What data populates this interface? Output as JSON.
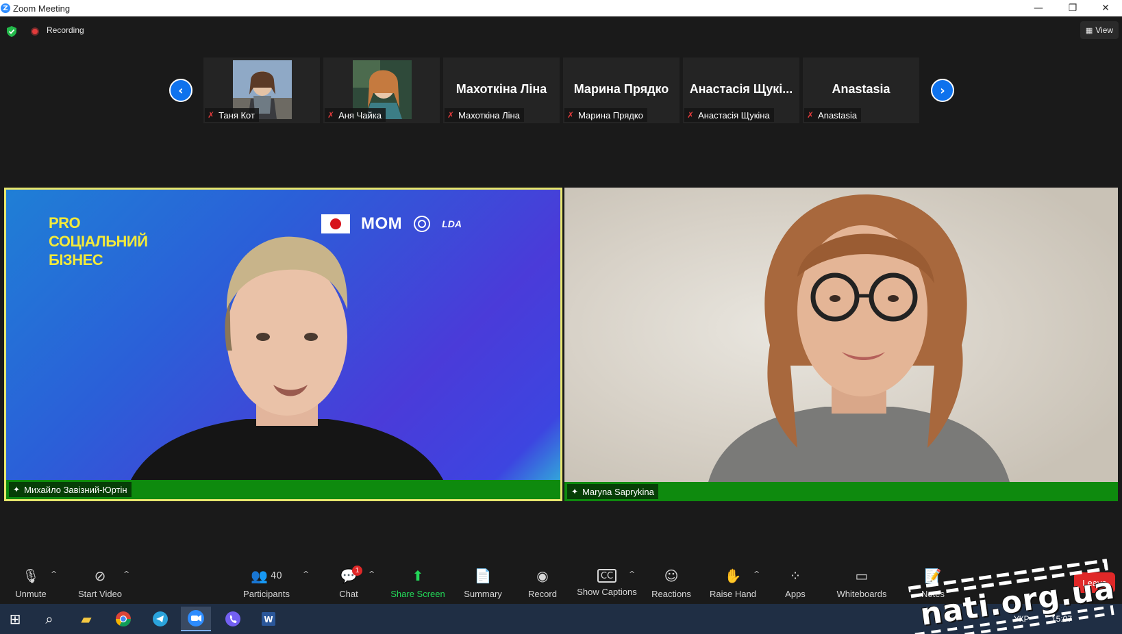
{
  "window": {
    "title": "Zoom Meeting"
  },
  "status": {
    "recording_label": "Recording",
    "view_label": "View"
  },
  "thumbnails": [
    {
      "display_name": "",
      "label": "Таня Кот",
      "has_video": true
    },
    {
      "display_name": "",
      "label": "Аня Чайка",
      "has_video": true
    },
    {
      "display_name": "Махоткіна Ліна",
      "label": "Махоткіна Ліна",
      "has_video": false
    },
    {
      "display_name": "Марина Прядко",
      "label": "Марина Прядко",
      "has_video": false
    },
    {
      "display_name": "Анастасія Щукі...",
      "label": "Анастасія Щукіна",
      "has_video": false
    },
    {
      "display_name": "Anastasia",
      "label": "Anastasia",
      "has_video": false
    }
  ],
  "main": {
    "left": {
      "name": "Михайло Завізний-Юртін",
      "banner_lines": [
        "PRO",
        "СОЦІАЛЬНИЙ",
        "БІЗНЕС"
      ],
      "logo_mom": "МОМ",
      "logo_lda": "LDA"
    },
    "right": {
      "name": "Maryna Saprykina"
    }
  },
  "toolbar": {
    "unmute": "Unmute",
    "start_video": "Start Video",
    "participants": "Participants",
    "participants_count": "40",
    "chat": "Chat",
    "chat_badge": "1",
    "share_screen": "Share Screen",
    "summary": "Summary",
    "record": "Record",
    "show_captions": "Show Captions",
    "reactions": "Reactions",
    "raise_hand": "Raise Hand",
    "apps": "Apps",
    "whiteboards": "Whiteboards",
    "notes": "Notes",
    "leave": "Leave"
  },
  "taskbar": {
    "language": "УКР",
    "time": "15:07"
  },
  "watermark": {
    "text": "nati.org.ua"
  },
  "colors": {
    "accent": "#0e72ed",
    "active_speaker_border": "#e7e66d",
    "name_bar_green": "#0e8a0e",
    "share_green": "#23d959",
    "leave_red": "#e02828"
  },
  "icons": [
    "shield-icon",
    "record-dot-icon",
    "grid-icon",
    "chevron-left-icon",
    "chevron-right-icon",
    "mic-muted-icon",
    "video-off-icon",
    "participants-icon",
    "chat-icon",
    "share-screen-icon",
    "summary-icon",
    "record-icon",
    "captions-icon",
    "reactions-icon",
    "raise-hand-icon",
    "apps-icon",
    "whiteboard-icon",
    "notes-icon",
    "windows-start-icon",
    "search-icon",
    "folder-icon",
    "chrome-icon",
    "telegram-icon",
    "zoom-icon",
    "viber-icon",
    "word-icon"
  ]
}
